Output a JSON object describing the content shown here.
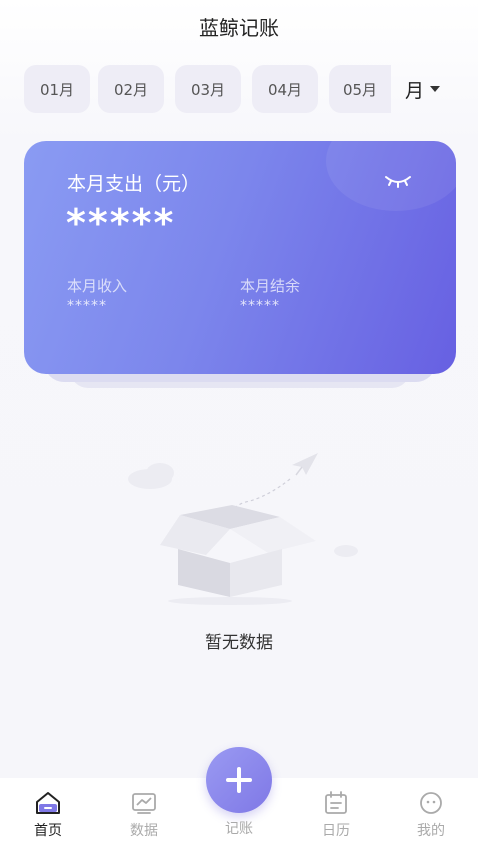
{
  "header": {
    "title": "蓝鲸记账"
  },
  "months": [
    "01月",
    "02月",
    "03月",
    "04月",
    "05月"
  ],
  "period": {
    "selected": "月"
  },
  "summary": {
    "expense_label": "本月支出（元）",
    "expense_value": "*****",
    "income_label": "本月收入",
    "income_value": "*****",
    "balance_label": "本月结余",
    "balance_value": "*****",
    "visibility_icon": "eye-closed-icon"
  },
  "empty_state": {
    "text": "暂无数据",
    "illustration": "empty-box-illustration"
  },
  "nav": {
    "home": "首页",
    "stats": "数据",
    "add": "记账",
    "calendar": "日历",
    "mine": "我的"
  },
  "colors": {
    "card_start": "#8a9bf3",
    "card_end": "#6760e2",
    "accent": "#7f78e6"
  }
}
